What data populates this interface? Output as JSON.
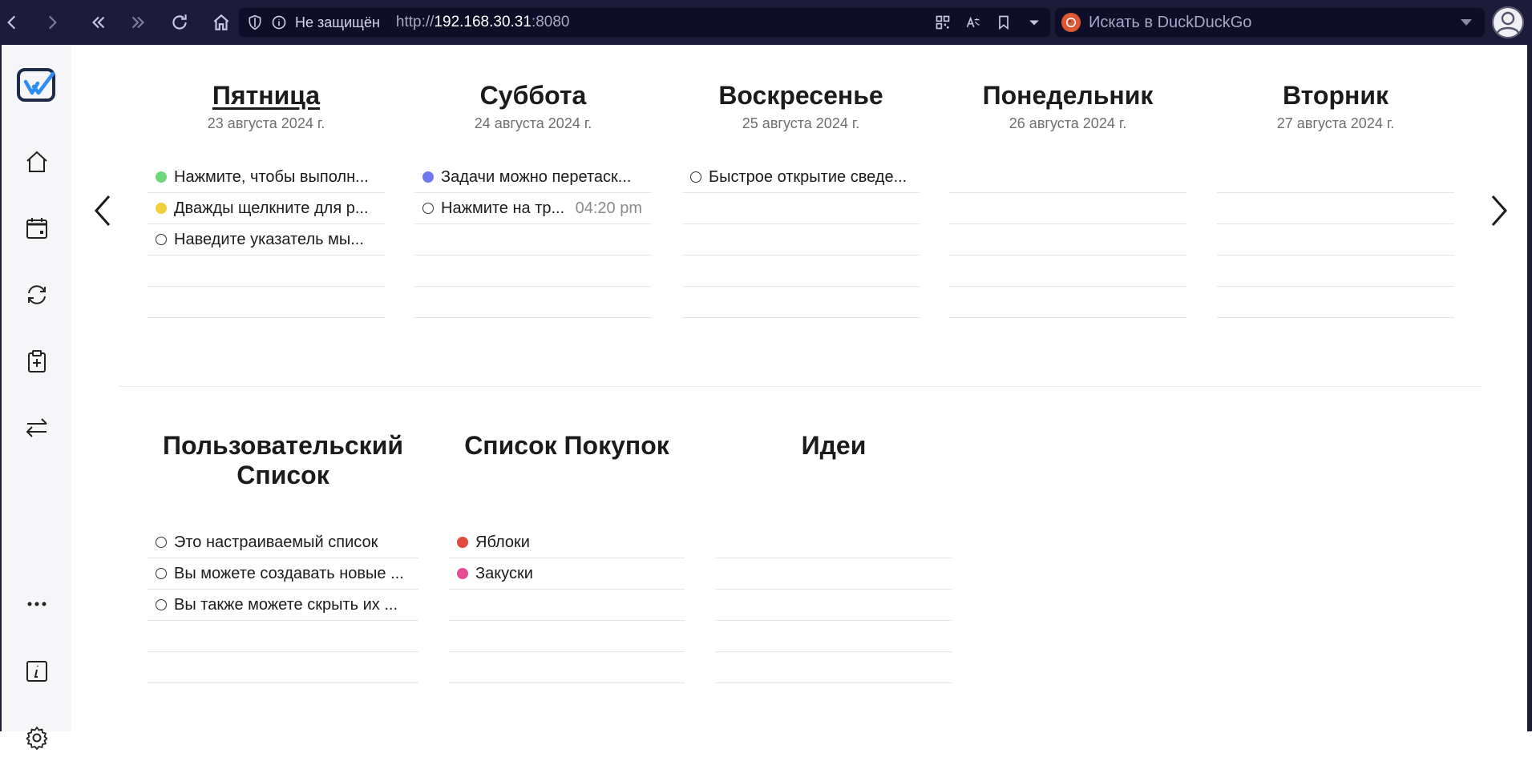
{
  "browser": {
    "security_label": "Не защищён",
    "url_scheme": "http://",
    "url_host": "192.168.30.31",
    "url_port": ":8080",
    "search_placeholder": "Искать в DuckDuckGo",
    "icons": [
      "back-icon",
      "forward-icon",
      "first-page-icon",
      "last-page-icon",
      "reload-icon",
      "home-icon",
      "shield-icon",
      "info-icon",
      "qr-code-icon",
      "translate-icon",
      "bookmark-icon",
      "dropdown-icon",
      "duckduckgo-icon",
      "profile-icon"
    ]
  },
  "sidebar": {
    "icons": [
      "app-logo-icon",
      "home-icon",
      "calendar-icon",
      "sync-icon",
      "clipboard-add-icon",
      "transfer-icon",
      "more-icon",
      "info-icon",
      "settings-icon"
    ]
  },
  "week": {
    "days": [
      {
        "name": "Пятница",
        "date": "23 августа 2024 г.",
        "today": true,
        "items": [
          {
            "text": "Нажмите, чтобы выполн...",
            "color": "#6fd67a",
            "time": ""
          },
          {
            "text": "Дважды щелкните для р...",
            "color": "#f2cf3c",
            "time": ""
          },
          {
            "text": "Наведите указатель мы...",
            "color": "",
            "time": ""
          }
        ]
      },
      {
        "name": "Суббота",
        "date": "24 августа 2024 г.",
        "today": false,
        "items": [
          {
            "text": "Задачи можно перетаск...",
            "color": "#6e78f0",
            "time": ""
          },
          {
            "text": "Нажмите на тр...",
            "color": "",
            "time": "04:20 pm"
          }
        ]
      },
      {
        "name": "Воскресенье",
        "date": "25 августа 2024 г.",
        "today": false,
        "items": [
          {
            "text": "Быстрое открытие сведе...",
            "color": "",
            "time": ""
          }
        ]
      },
      {
        "name": "Понедельник",
        "date": "26 августа 2024 г.",
        "today": false,
        "items": []
      },
      {
        "name": "Вторник",
        "date": "27 августа 2024 г.",
        "today": false,
        "items": []
      }
    ]
  },
  "lists": [
    {
      "title": "Пользовательский Список",
      "items": [
        {
          "text": "Это настраиваемый список",
          "color": ""
        },
        {
          "text": "Вы можете создавать новые ...",
          "color": ""
        },
        {
          "text": "Вы также можете скрыть их ...",
          "color": ""
        }
      ]
    },
    {
      "title": "Список Покупок",
      "items": [
        {
          "text": "Яблоки",
          "color": "#e2493f"
        },
        {
          "text": "Закуски",
          "color": "#e64c96"
        }
      ]
    },
    {
      "title": "Идеи",
      "items": []
    }
  ]
}
